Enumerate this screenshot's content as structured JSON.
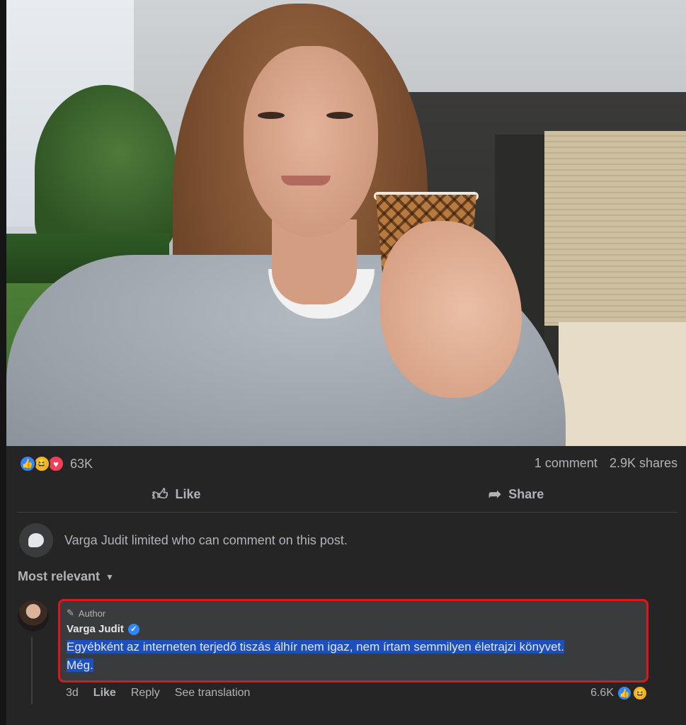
{
  "post": {
    "photo_icon": "selfie-photo",
    "reactions": {
      "icons": [
        "like-icon",
        "haha-icon",
        "love-icon"
      ],
      "count": "63K"
    },
    "comments_count": "1 comment",
    "shares_count": "2.9K shares",
    "actions": {
      "like_label": "Like",
      "share_label": "Share"
    },
    "notice": "Varga Judit limited who can comment on this post.",
    "sort_label": "Most relevant"
  },
  "comment": {
    "author_tag": "Author",
    "name": "Varga Judit",
    "text_line1": "Egyébként az interneten terjedő tiszás álhír nem igaz, nem írtam semmilyen életrajzi könyvet.",
    "text_line2": "Még.",
    "time": "3d",
    "like_label": "Like",
    "reply_label": "Reply",
    "translate_label": "See translation",
    "reaction_count": "6.6K",
    "highlight_color": "#e0161c"
  },
  "colors": {
    "background": "#252526",
    "accent": "#2d88ff",
    "text_muted": "#b0b3b8"
  }
}
